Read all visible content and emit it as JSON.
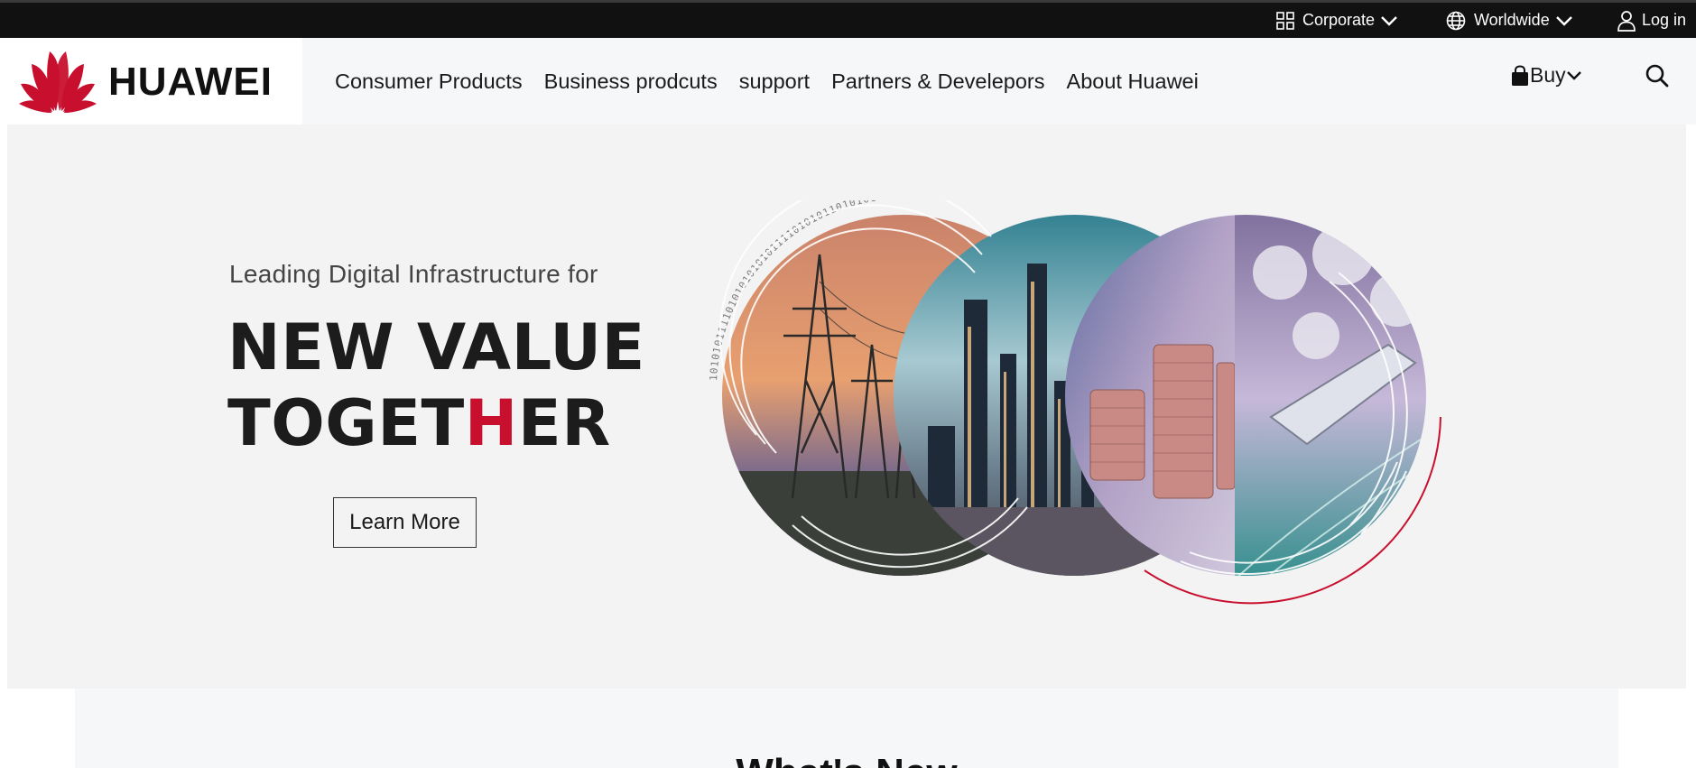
{
  "topbar": {
    "corporate_label": "Corporate",
    "worldwide_label": "Worldwide",
    "login_label": "Log in"
  },
  "logo": {
    "text": "HUAWEI",
    "color": "#c8102e"
  },
  "nav": {
    "items": [
      {
        "label": "Consumer Products"
      },
      {
        "label": "Business prodcuts"
      },
      {
        "label": "support"
      },
      {
        "label": "Partners & Develepors"
      },
      {
        "label": "About Huawei"
      }
    ],
    "buy_label": "Buy"
  },
  "hero": {
    "subtitle": "Leading Digital Infrastructure for",
    "title_line1": "NEW VALUE",
    "title_line2_a": "TOGET",
    "title_line2_b": "H",
    "title_line2_c": "ER",
    "cta_label": "Learn More",
    "binary_text": "1010101111010101010101111010101101010101",
    "accent_color": "#c8102e"
  },
  "section": {
    "heading": "What's New"
  }
}
